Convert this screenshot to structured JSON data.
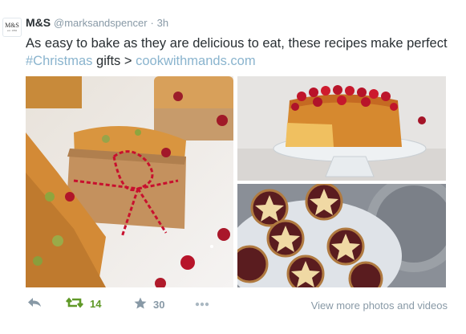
{
  "tweet": {
    "avatar_text": "M&S",
    "avatar_small": "est. 1884",
    "name": "M&S",
    "handle": "@marksandspencer",
    "separator": "·",
    "time": "3h",
    "text_line1": "As easy to bake as they are delicious to eat, these recipes make perfect",
    "hashtag": "#Christmas",
    "text_gifts": "gifts >",
    "link": "cookwithmands.com"
  },
  "photos": [
    {
      "subject": "cakes-with-twine"
    },
    {
      "subject": "cranberry-cake"
    },
    {
      "subject": "star-mince-pies"
    }
  ],
  "actions": {
    "retweet_count": "14",
    "favorite_count": "30",
    "view_more": "View more photos and videos"
  },
  "colors": {
    "retweet": "#609928",
    "muted": "#8899a6",
    "link": "#8ab4ce"
  }
}
